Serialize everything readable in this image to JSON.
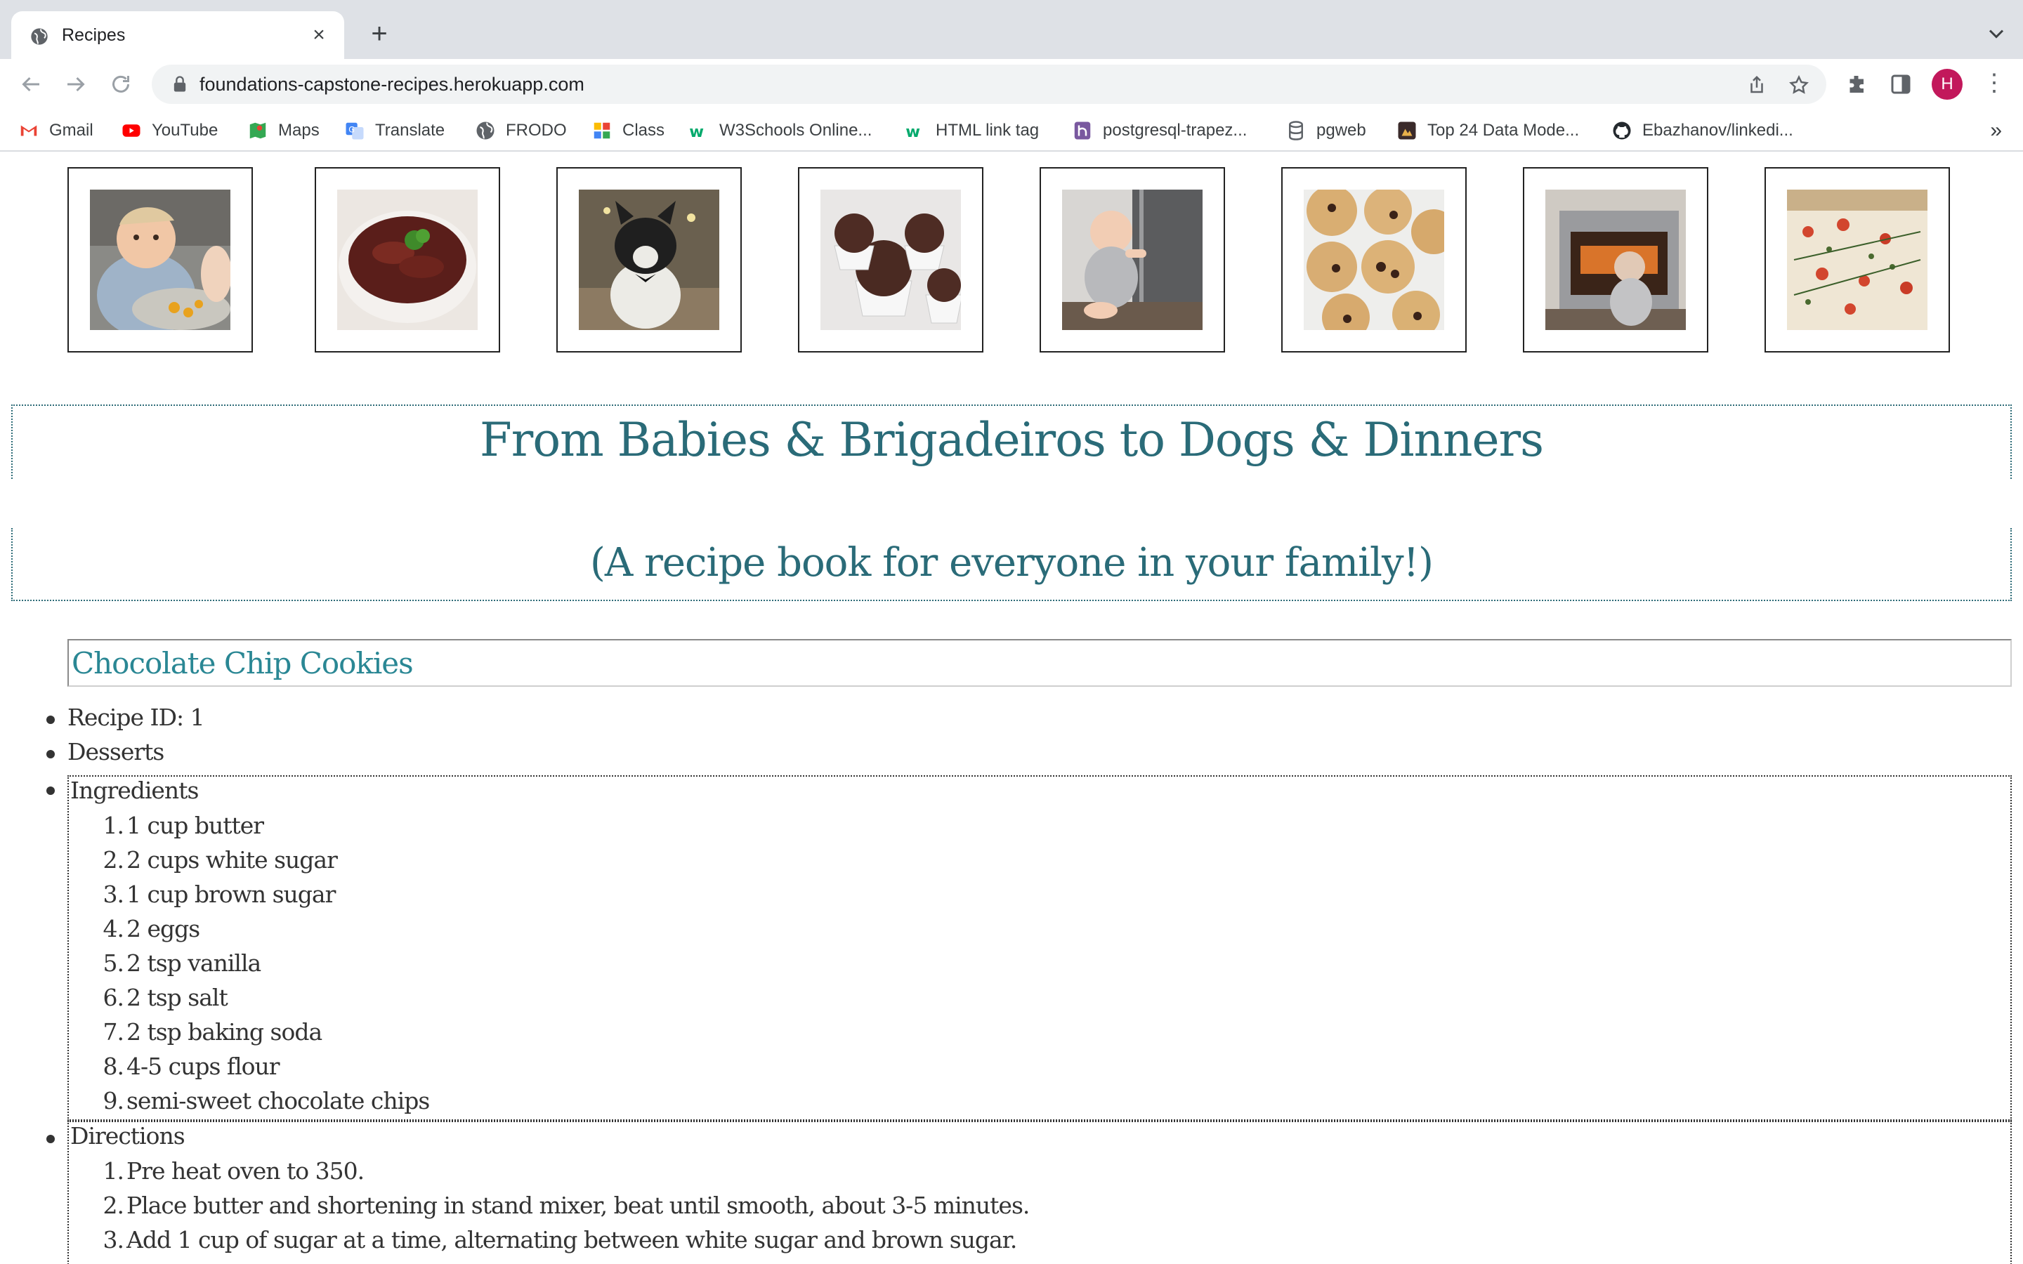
{
  "browser": {
    "tab_title": "Recipes",
    "url": "foundations-capstone-recipes.herokuapp.com",
    "avatar_letter": "H",
    "bookmarks": [
      {
        "label": "Gmail",
        "icon": "gmail-icon"
      },
      {
        "label": "YouTube",
        "icon": "youtube-icon"
      },
      {
        "label": "Maps",
        "icon": "maps-icon"
      },
      {
        "label": "Translate",
        "icon": "translate-icon"
      },
      {
        "label": "FRODO",
        "icon": "globe-icon"
      },
      {
        "label": "Class",
        "icon": "class-icon"
      },
      {
        "label": "W3Schools Online...",
        "icon": "w3schools-icon"
      },
      {
        "label": "HTML link tag",
        "icon": "w3schools-icon"
      },
      {
        "label": "postgresql-trapez...",
        "icon": "heroku-icon"
      },
      {
        "label": "pgweb",
        "icon": "database-icon"
      },
      {
        "label": "Top 24 Data Mode...",
        "icon": "site-icon"
      },
      {
        "label": "Ebazhanov/linkedi...",
        "icon": "github-icon"
      }
    ]
  },
  "gallery": [
    {
      "alt": "baby eating"
    },
    {
      "alt": "bowl of beans"
    },
    {
      "alt": "dog in bow tie"
    },
    {
      "alt": "brigadeiros"
    },
    {
      "alt": "baby at fridge"
    },
    {
      "alt": "chocolate chip cookies"
    },
    {
      "alt": "baby at oven"
    },
    {
      "alt": "flatbread pizza"
    }
  ],
  "hero": {
    "title": "From Babies & Brigadeiros to Dogs & Dinners",
    "subtitle": "(A recipe book for everyone in your family!)"
  },
  "recipe": {
    "title": "Chocolate Chip Cookies",
    "id_line": "Recipe ID: 1",
    "category": "Desserts",
    "ingredients_label": "Ingredients",
    "ingredients": [
      "1 cup butter",
      "2 cups white sugar",
      "1 cup brown sugar",
      "2 eggs",
      "2 tsp vanilla",
      "2 tsp salt",
      "2 tsp baking soda",
      "4-5 cups flour",
      "semi-sweet chocolate chips"
    ],
    "directions_label": "Directions",
    "directions": [
      "Pre heat oven to 350.",
      "Place butter and shortening in stand mixer, beat until smooth, about 3-5 minutes.",
      "Add 1 cup of sugar at a time, alternating between white sugar and brown sugar."
    ]
  },
  "colors": {
    "heading_teal": "#2a6b78",
    "recipe_title_teal": "#2a8794",
    "avatar": "#c2185b"
  }
}
